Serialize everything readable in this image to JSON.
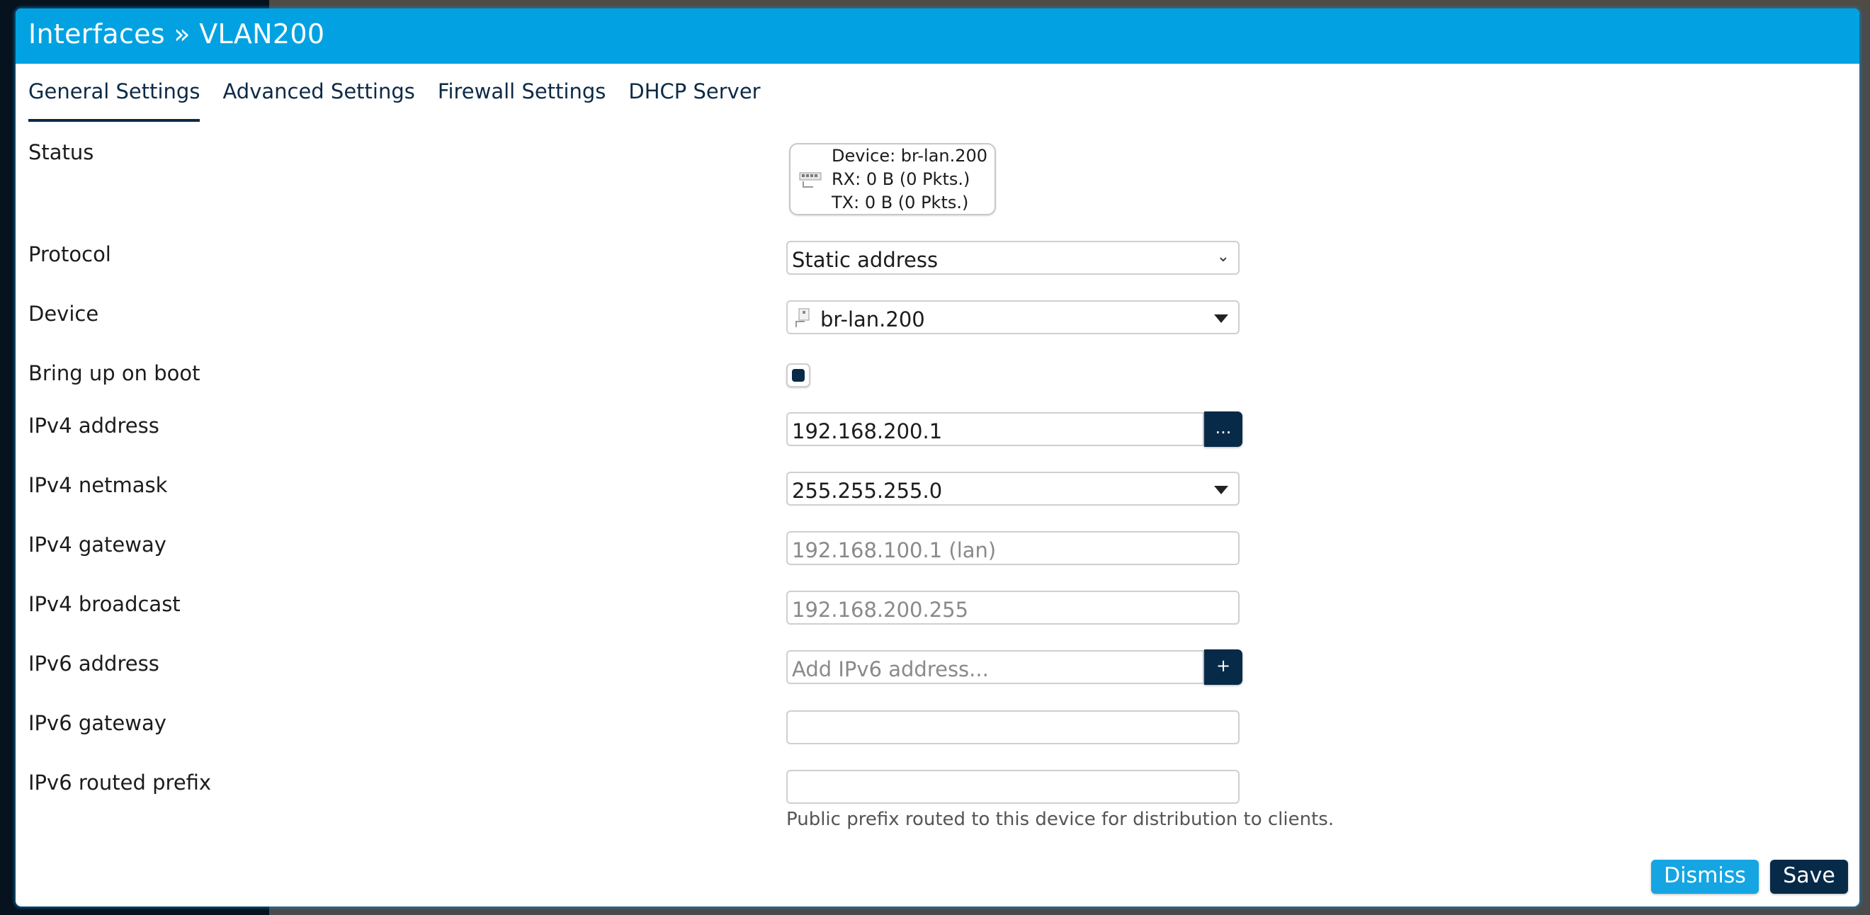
{
  "modal": {
    "title": "Interfaces » VLAN200"
  },
  "tabs": [
    {
      "label": "General Settings",
      "active": true
    },
    {
      "label": "Advanced Settings",
      "active": false
    },
    {
      "label": "Firewall Settings",
      "active": false
    },
    {
      "label": "DHCP Server",
      "active": false
    }
  ],
  "form": {
    "status": {
      "label": "Status",
      "device": "Device: br-lan.200",
      "rx": "RX: 0 B (0 Pkts.)",
      "tx": "TX: 0 B (0 Pkts.)",
      "icon": "network-port-icon"
    },
    "protocol": {
      "label": "Protocol",
      "value": "Static address"
    },
    "device": {
      "label": "Device",
      "value": "br-lan.200",
      "icon": "network-device-icon"
    },
    "bring_up_on_boot": {
      "label": "Bring up on boot",
      "checked": true
    },
    "ipv4_address": {
      "label": "IPv4 address",
      "value": "192.168.200.1",
      "addon_label": "..."
    },
    "ipv4_netmask": {
      "label": "IPv4 netmask",
      "value": "255.255.255.0"
    },
    "ipv4_gateway": {
      "label": "IPv4 gateway",
      "value": "",
      "placeholder": "192.168.100.1 (lan)"
    },
    "ipv4_broadcast": {
      "label": "IPv4 broadcast",
      "value": "",
      "placeholder": "192.168.200.255"
    },
    "ipv6_address": {
      "label": "IPv6 address",
      "value": "",
      "placeholder": "Add IPv6 address...",
      "addon_label": "+"
    },
    "ipv6_gateway": {
      "label": "IPv6 gateway",
      "value": ""
    },
    "ipv6_routed_prefix": {
      "label": "IPv6 routed prefix",
      "value": "",
      "help": "Public prefix routed to this device for distribution to clients."
    }
  },
  "footer": {
    "dismiss_label": "Dismiss",
    "save_label": "Save"
  },
  "colors": {
    "header": "#02a2e2",
    "primary_dark": "#072a48",
    "dismiss": "#15a5e3"
  }
}
